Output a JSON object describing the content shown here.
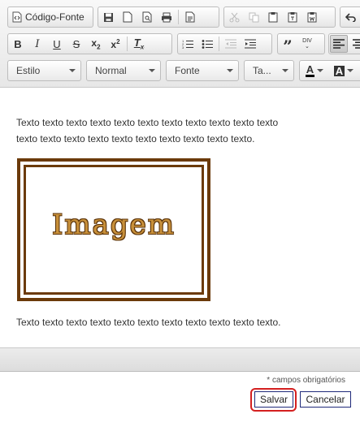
{
  "toolbar": {
    "source_label": "Código-Fonte",
    "style_combo": "Estilo",
    "format_combo": "Normal",
    "font_combo": "Fonte",
    "size_combo": "Ta...",
    "text_color_label": "A",
    "bg_color_label": "A"
  },
  "content": {
    "paragraph_1_line_1": "Texto texto texto texto texto texto texto texto texto texto texto",
    "paragraph_1_line_2": "texto texto texto texto texto texto texto texto texto texto.",
    "image_text": "Imagem",
    "paragraph_2": "Texto texto texto texto texto texto texto texto texto texto texto."
  },
  "form": {
    "required_note": "* campos obrigatórios",
    "save_label": "Salvar",
    "cancel_label": "Cancelar"
  },
  "colors": {
    "frame": "#6b3a0a",
    "highlight": "#d42020",
    "button_border": "#1f2a7a"
  }
}
